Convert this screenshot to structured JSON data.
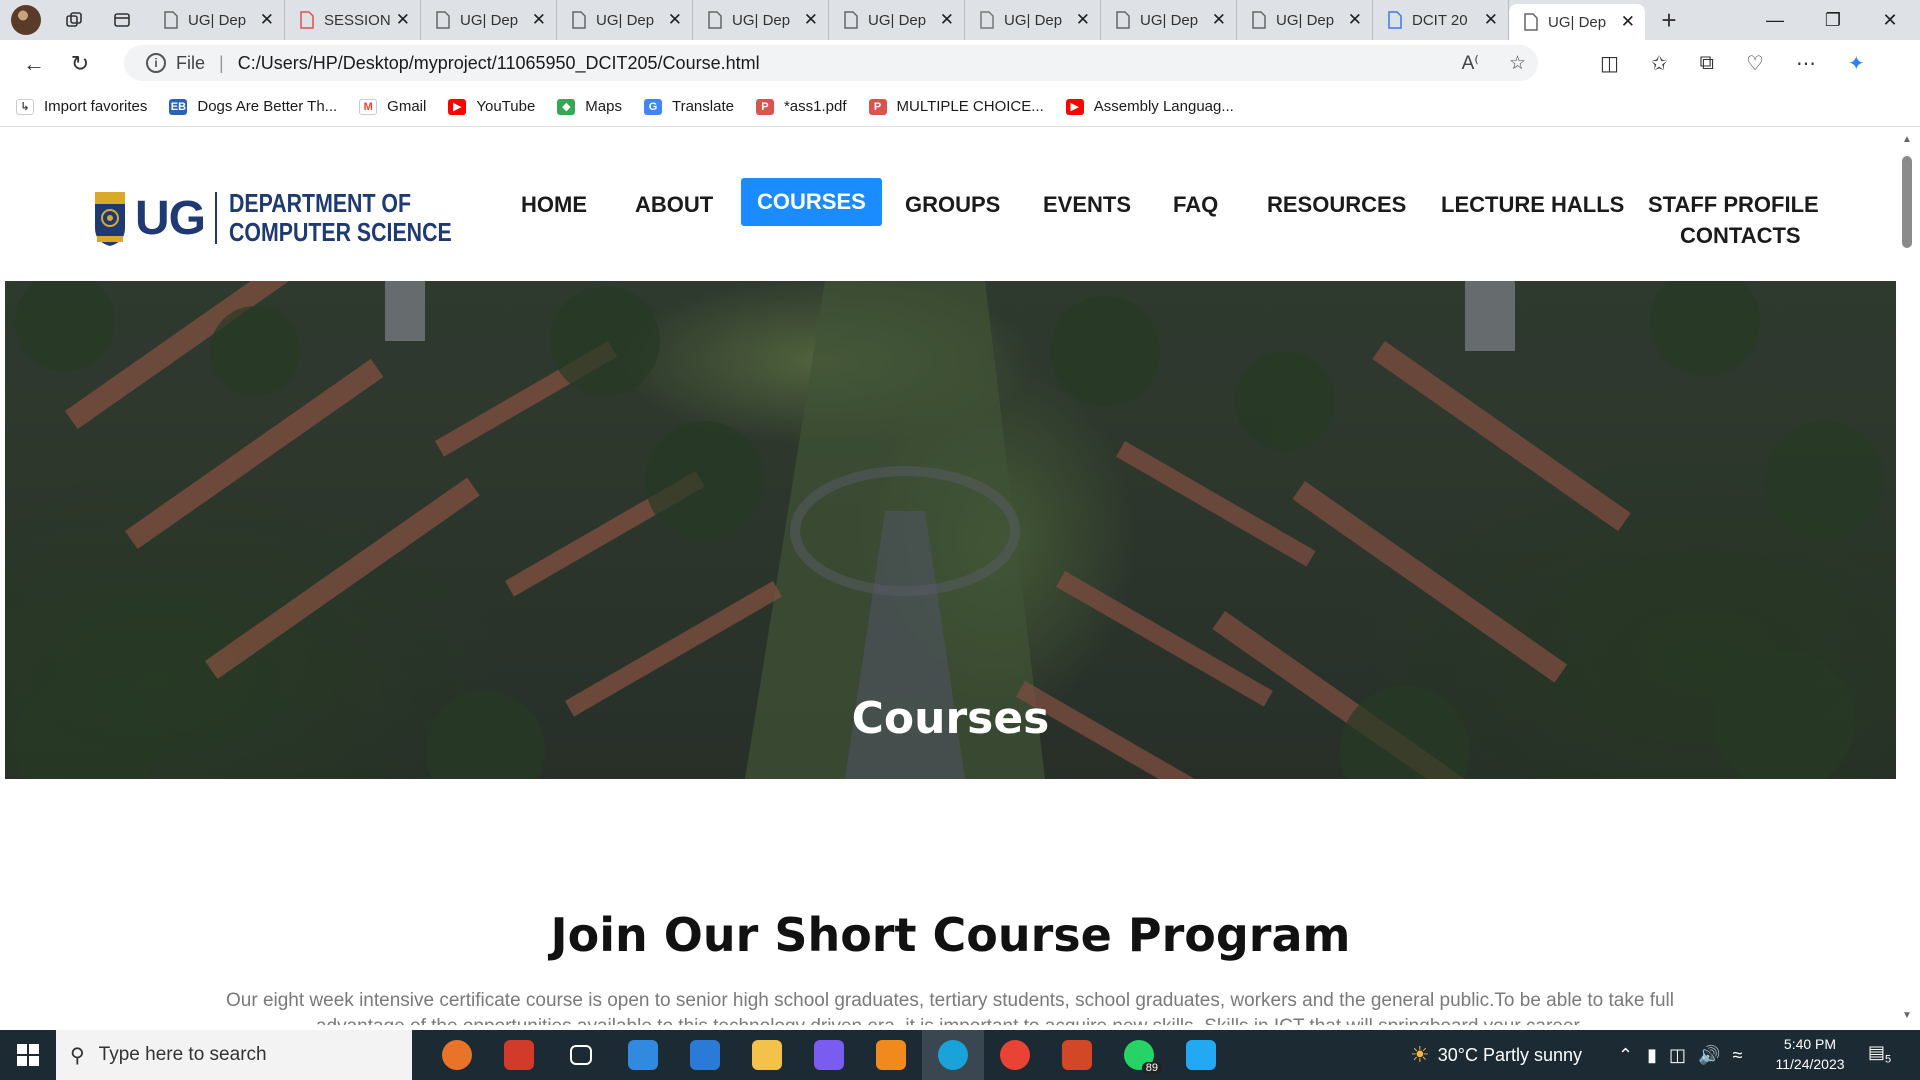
{
  "browser": {
    "tabs": [
      {
        "label": "UG| Dep",
        "icon": "page-icon"
      },
      {
        "label": "SESSION",
        "icon": "pdf-icon"
      },
      {
        "label": "UG| Dep",
        "icon": "page-icon"
      },
      {
        "label": "UG| Dep",
        "icon": "page-icon"
      },
      {
        "label": "UG| Dep",
        "icon": "page-icon"
      },
      {
        "label": "UG| Dep",
        "icon": "page-icon"
      },
      {
        "label": "UG| Dep",
        "icon": "shield-icon"
      },
      {
        "label": "UG| Dep",
        "icon": "page-icon"
      },
      {
        "label": "UG| Dep",
        "icon": "page-icon"
      },
      {
        "label": "DCIT 20",
        "icon": "doc-icon"
      },
      {
        "label": "UG| Dep",
        "icon": "page-icon"
      }
    ],
    "active_tab_index": 10,
    "new_tab_label": "+",
    "address": {
      "scheme_label": "File",
      "url": "C:/Users/HP/Desktop/myproject/11065950_DCIT205/Course.html"
    },
    "favorites": [
      {
        "label": "Import favorites",
        "icon": "import-icon"
      },
      {
        "label": "Dogs Are Better Th...",
        "icon": "eb-icon"
      },
      {
        "label": "Gmail",
        "icon": "gmail-icon"
      },
      {
        "label": "YouTube",
        "icon": "youtube-icon"
      },
      {
        "label": "Maps",
        "icon": "maps-icon"
      },
      {
        "label": "Translate",
        "icon": "translate-icon"
      },
      {
        "label": "*ass1.pdf",
        "icon": "pdf-icon"
      },
      {
        "label": "MULTIPLE CHOICE...",
        "icon": "pdf-icon"
      },
      {
        "label": "Assembly Languag...",
        "icon": "youtube-icon"
      }
    ]
  },
  "site": {
    "logo": {
      "short": "UG",
      "line1": "DEPARTMENT OF",
      "line2": "COMPUTER SCIENCE"
    },
    "nav": {
      "home": "HOME",
      "about": "ABOUT",
      "courses": "COURSES",
      "groups": "GROUPS",
      "events": "EVENTS",
      "faq": "FAQ",
      "resources": "RESOURCES",
      "lecture_halls": "LECTURE HALLS",
      "staff_profile": "STAFF PROFILE",
      "contacts": "CONTACTS"
    },
    "active_nav": "courses",
    "hero_title": "Courses",
    "section_title": "Join Our Short Course Program",
    "section_body": "Our eight week intensive certificate course is open to senior high school graduates, tertiary students, school graduates, workers and the general public.To be able to take full advantage of the opportunities available to this technology driven era, it is important to acquire new skills. Skills in ICT that will springboard your career."
  },
  "taskbar": {
    "search_placeholder": "Type here to search",
    "apps": [
      {
        "name": "alarm-icon",
        "color": "#e8742a"
      },
      {
        "name": "gift-icon",
        "color": "#d23b2c"
      },
      {
        "name": "task-view-icon",
        "color": "#ffffff"
      },
      {
        "name": "store-icon",
        "color": "#2f8ae0"
      },
      {
        "name": "mail-icon",
        "color": "#2b7bd6"
      },
      {
        "name": "file-explorer-icon",
        "color": "#f2c24b"
      },
      {
        "name": "clipchamp-icon",
        "color": "#7a5cf0"
      },
      {
        "name": "vlc-icon",
        "color": "#f08a1c"
      },
      {
        "name": "edge-icon",
        "color": "#1aa3d8"
      },
      {
        "name": "chrome-icon",
        "color": "#e94335"
      },
      {
        "name": "powerpoint-icon",
        "color": "#d24726"
      },
      {
        "name": "whatsapp-icon",
        "color": "#25d366"
      },
      {
        "name": "vscode-icon",
        "color": "#23a9f2"
      }
    ],
    "whatsapp_badge": "89",
    "weather": "30°C  Partly sunny",
    "time": "5:40 PM",
    "date": "11/24/2023",
    "notification_count": "5"
  }
}
